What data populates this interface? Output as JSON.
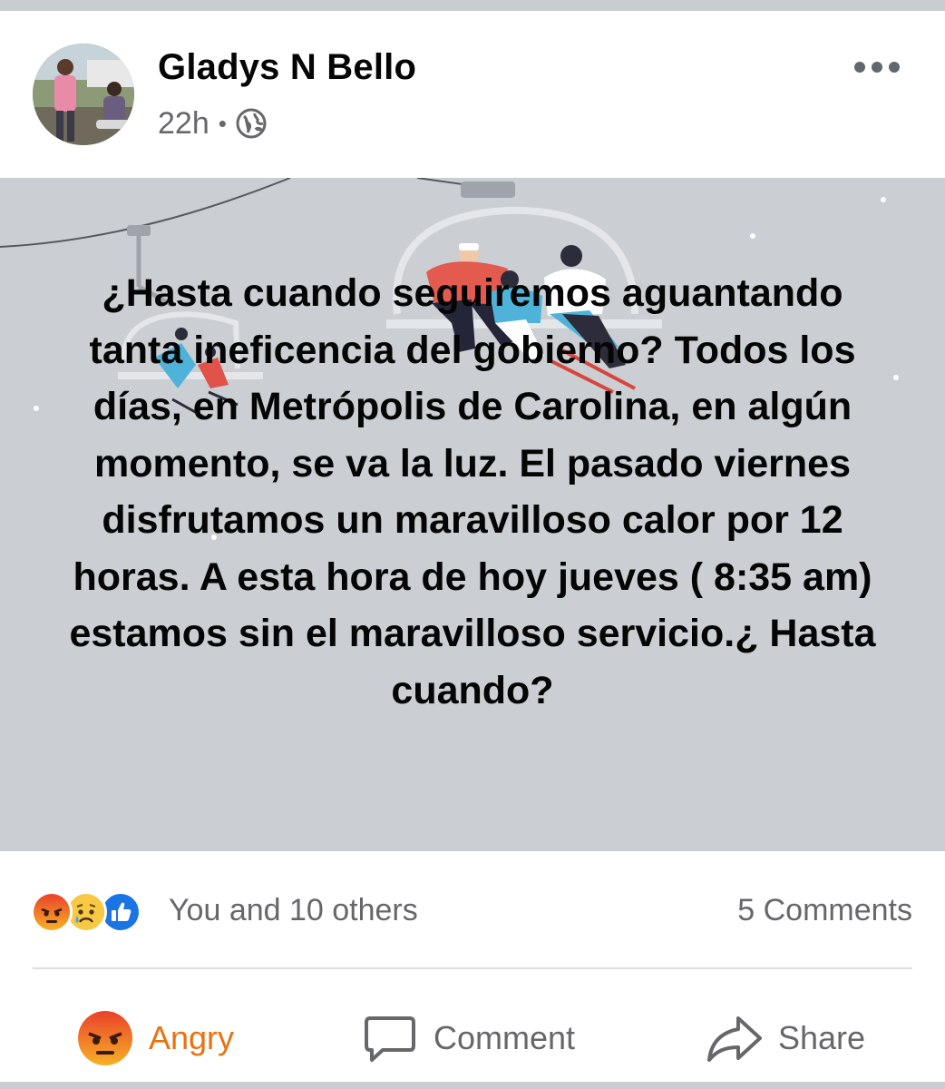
{
  "post": {
    "author": "Gladys N Bello",
    "time": "22h",
    "separator": "•",
    "audience_icon": "globe-icon",
    "menu_icon": "more-options-icon",
    "text": "¿Hasta cuando seguiremos aguantando  tanta ineficencia del gobierno? Todos los días, en Metrópolis de Carolina, en algún momento, se va la luz. El pasado viernes disfrutamos un maravilloso calor por 12 horas. A esta hora de hoy jueves ( 8:35 am) estamos sin el maravilloso servicio.¿ Hasta cuando?",
    "background_color": "#cbced2"
  },
  "summary": {
    "reactions": [
      "angry-icon",
      "sad-icon",
      "like-icon"
    ],
    "text": "You and 10 others",
    "comments": "5 Comments"
  },
  "actions": {
    "reaction_label": "Angry",
    "reaction_color": "#e9710f",
    "comment_label": "Comment",
    "share_label": "Share"
  }
}
